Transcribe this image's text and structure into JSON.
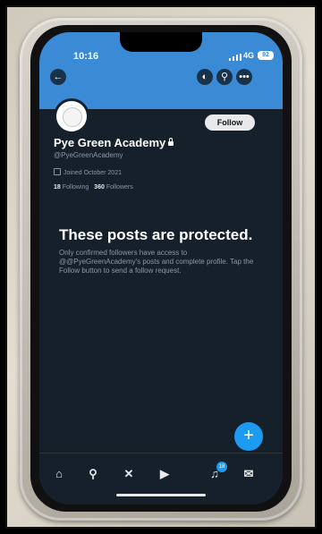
{
  "status_bar": {
    "time": "10:16",
    "network": "4G",
    "battery": "92"
  },
  "profile": {
    "name": "Pye Green Academy",
    "handle": "@PyeGreenAcademy",
    "joined": "Joined October 2021",
    "following_count": "18",
    "following_label": "Following",
    "followers_count": "360",
    "followers_label": "Followers",
    "follow_label": "Follow"
  },
  "protected": {
    "title": "These posts are protected.",
    "description": "Only confirmed followers have access to @@PyeGreenAcademy's posts and complete profile. Tap the Follow button to send a follow request."
  },
  "header_buttons": {
    "back_icon": "back-arrow-icon",
    "grok_icon": "grok-icon",
    "search_icon": "search-icon",
    "more_icon": "more-icon"
  },
  "bottom_nav": {
    "notification_badge": "18"
  },
  "fab": {
    "label": "+"
  },
  "colors": {
    "banner": "#3a8ad6",
    "background": "#15202b",
    "accent": "#1d9bf0"
  }
}
